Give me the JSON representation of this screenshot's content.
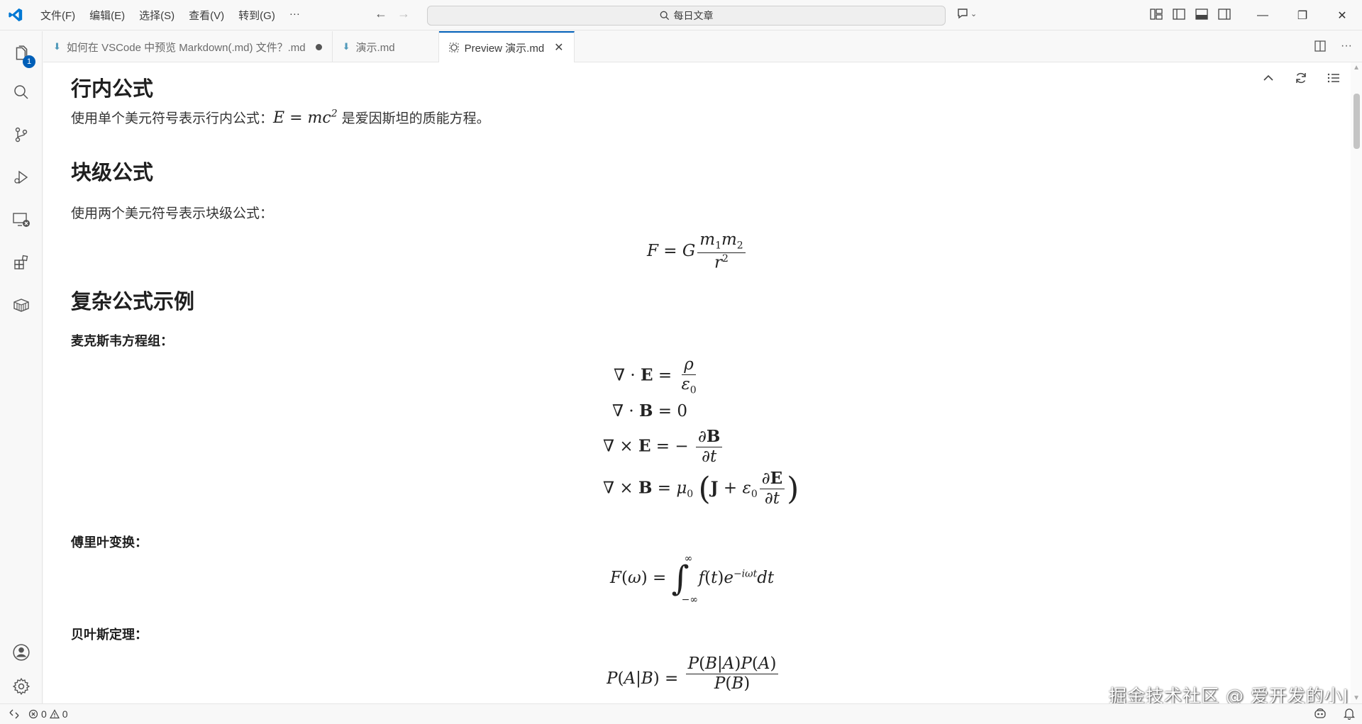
{
  "titlebar": {
    "menus": [
      "文件(F)",
      "编辑(E)",
      "选择(S)",
      "查看(V)",
      "转到(G)",
      "···"
    ],
    "search_text": "每日文章"
  },
  "activity": {
    "explorer_badge": "1"
  },
  "tabs": [
    {
      "label": "如何在 VSCode 中预览 Markdown(.md) 文件？.md",
      "state": "modified"
    },
    {
      "label": "演示.md",
      "state": "normal"
    },
    {
      "label": "Preview 演示.md",
      "state": "active"
    }
  ],
  "preview": {
    "h_inline": "行内公式",
    "p_inline_before": "使用单个美元符号表示行内公式：",
    "p_inline_after": "是爱因斯坦的质能方程。",
    "h_block": "块级公式",
    "p_block": "使用两个美元符号表示块级公式：",
    "h_complex": "复杂公式示例",
    "label_maxwell": "麦克斯韦方程组：",
    "label_fourier": "傅里叶变换：",
    "label_bayes": "贝叶斯定理："
  },
  "statusbar": {
    "errors": "0",
    "warnings": "0"
  },
  "watermark": "掘金技术社区 @ 爱开发的小J"
}
